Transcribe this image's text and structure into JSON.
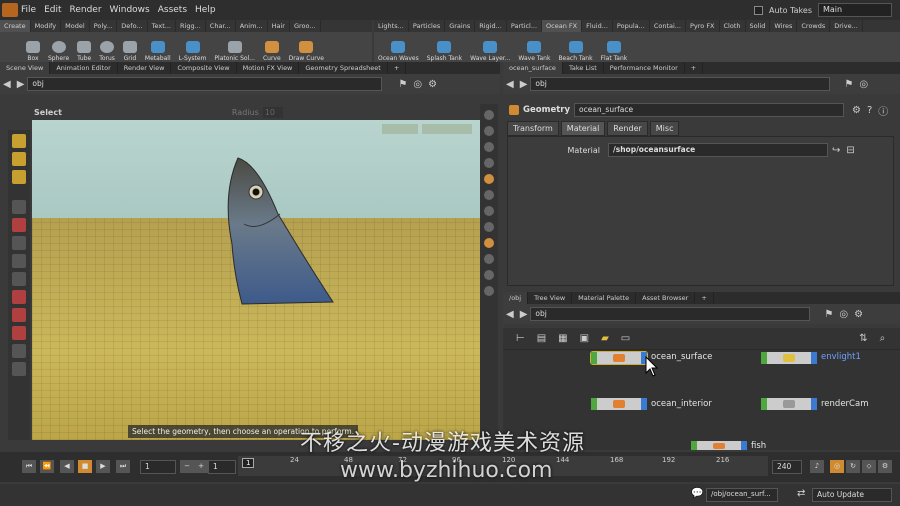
{
  "menu": {
    "items": [
      "File",
      "Edit",
      "Render",
      "Windows",
      "Assets",
      "Help"
    ],
    "auto_takes": "Auto Takes",
    "desktop": "Main"
  },
  "shelf": {
    "left_tabs": [
      "Create",
      "Modify",
      "Model",
      "Poly...",
      "Defo...",
      "Text...",
      "Rigg...",
      "Char...",
      "Anim...",
      "Hair",
      "Groo..."
    ],
    "right_tabs": [
      "Lights...",
      "Particles",
      "Grains",
      "Rigid...",
      "Particl...",
      "Ocean FX",
      "Fluid...",
      "Popula...",
      "Contai...",
      "Pyro FX",
      "Cloth",
      "Solid",
      "Wires",
      "Crowds",
      "Drive..."
    ],
    "left_tools": [
      "Box",
      "Sphere",
      "Tube",
      "Torus",
      "Grid",
      "Metaball",
      "L-System",
      "Platonic Sol...",
      "Curve",
      "Draw Curve"
    ],
    "right_tools": [
      "Ocean Waves",
      "Splash Tank",
      "Wave Layer...",
      "Wave Tank",
      "Beach Tank",
      "Flat Tank"
    ]
  },
  "left_pane": {
    "tabs": [
      "Scene View",
      "Animation Editor",
      "Render View",
      "Composite View",
      "Motion FX View",
      "Geometry Spreadsheet"
    ],
    "path": "obj",
    "mode": "Select",
    "radius_label": "Radius",
    "radius_value": "10",
    "hint": "Select the geometry, then choose an operation to perform."
  },
  "params_pane": {
    "tabs": [
      "ocean_surface",
      "Take List",
      "Performance Monitor"
    ],
    "path": "obj",
    "node_type": "Geometry",
    "node_name": "ocean_surface",
    "param_tabs": [
      "Transform",
      "Material",
      "Render",
      "Misc"
    ],
    "material_label": "Material",
    "material_value": "/shop/oceansurface"
  },
  "network_pane": {
    "tabs": [
      "/obj",
      "Tree View",
      "Material Palette",
      "Asset Browser"
    ],
    "path": "obj",
    "nodes": [
      "ocean_surface",
      "envlight1",
      "ocean_interior",
      "renderCam",
      "fish"
    ]
  },
  "timeline": {
    "current_frame": "1",
    "start": "1",
    "end": "240",
    "ticks": [
      "1",
      "24",
      "48",
      "72",
      "96",
      "120",
      "144",
      "168",
      "192",
      "216"
    ],
    "range_start": "1",
    "range_end": "240"
  },
  "status": {
    "path": "/obj/ocean_surf...",
    "update_mode": "Auto Update"
  },
  "watermark": {
    "line1": "不移之火-动漫游戏美术资源",
    "line2": "www.byzhihuo.com"
  }
}
